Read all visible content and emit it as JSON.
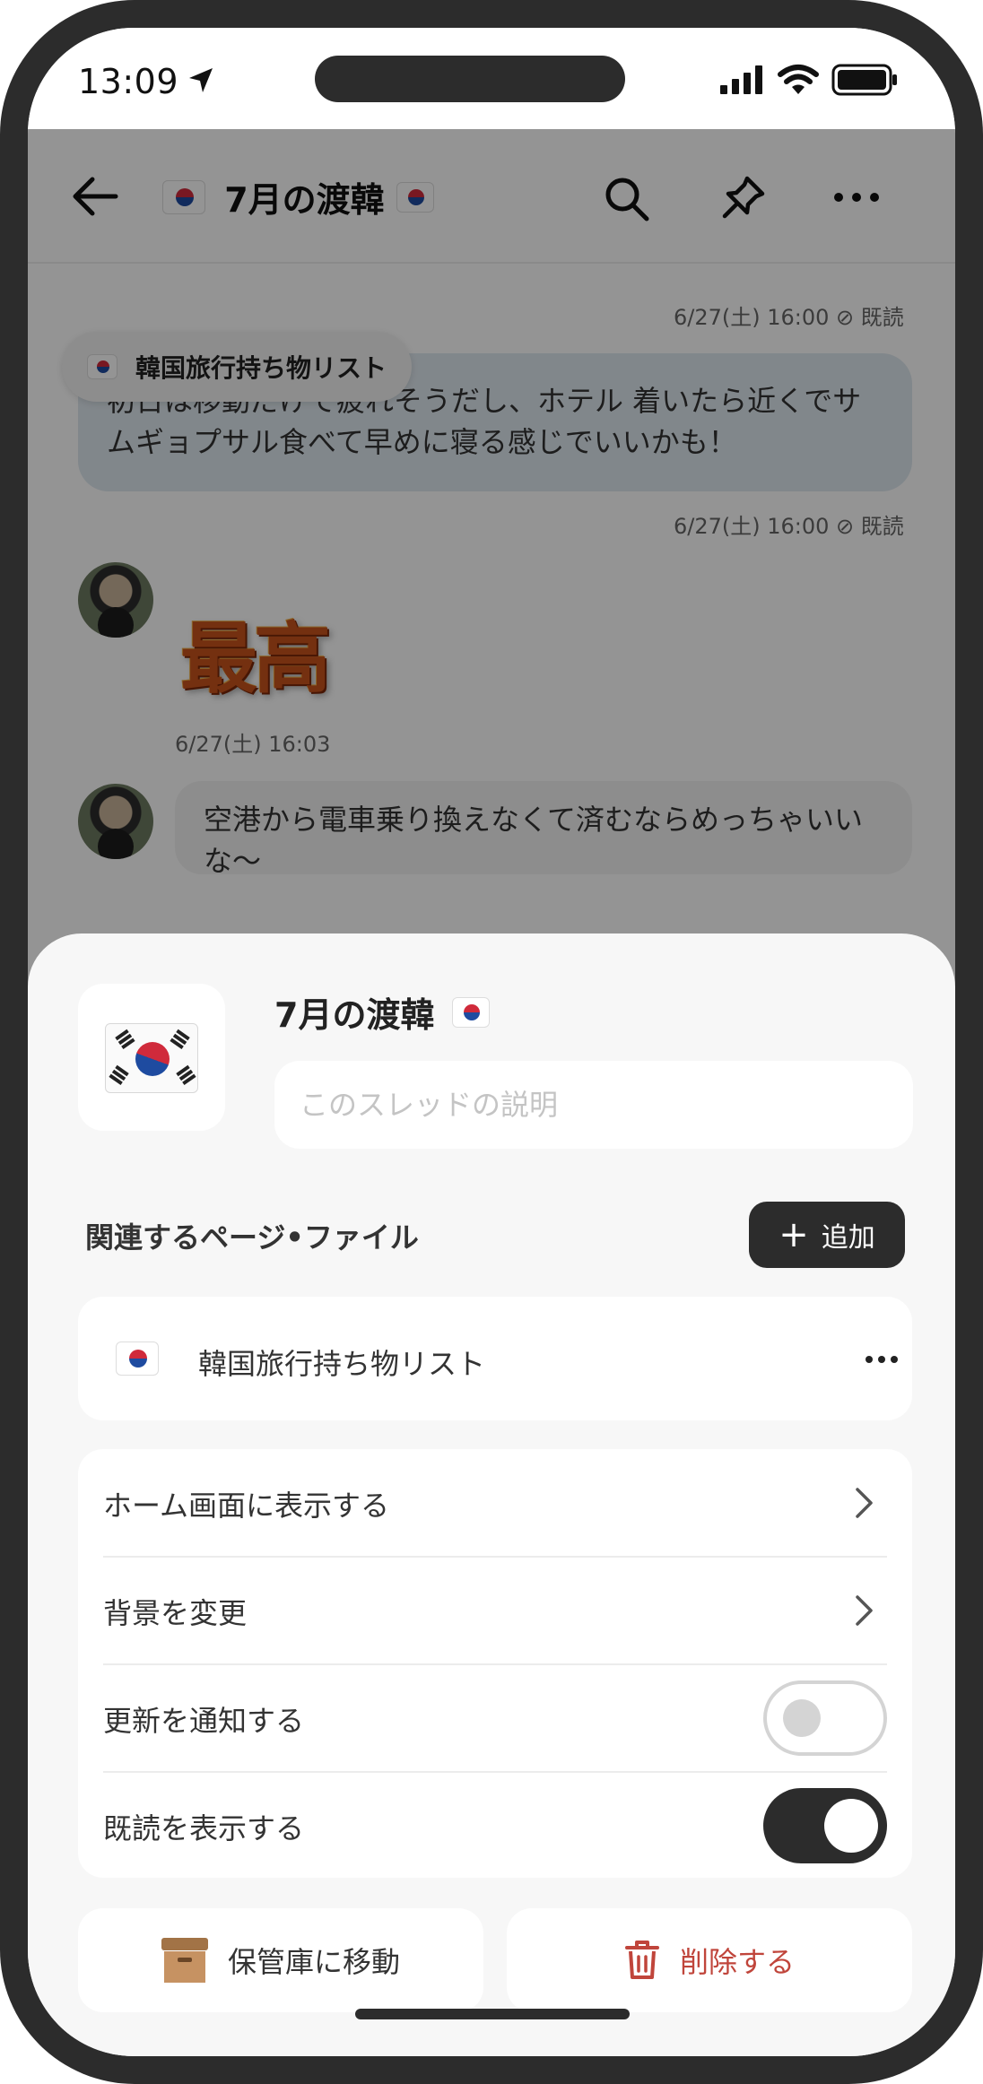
{
  "status_bar": {
    "time": "13:09"
  },
  "chat": {
    "thread_title": "7月の渡韓",
    "message1": {
      "text": "初日は移動だけで疲れそうだし、ホテル 着いたら近くでサムギョプサル食べて早めに寝る感じでいいかも！",
      "meta_above": "6/27(土) 16:00 ⊘ 既読",
      "meta_below": "6/27(土) 16:00 ⊘ 既読"
    },
    "pinned_chip": {
      "label": "韓国旅行持ち物リスト"
    },
    "sticker": {
      "text": "最高"
    },
    "message2": {
      "time": "6/27(土) 16:03",
      "text": "空港から電車乗り換えなくて済むならめっちゃいいな〜"
    }
  },
  "sheet": {
    "title": "7月の渡韓",
    "description": {
      "value": "",
      "placeholder": "このスレッドの説明"
    },
    "related_label": "関連するページ•ファイル",
    "add_label": "追加",
    "file_name": "韓国旅行持ち物リスト",
    "settings": [
      {
        "label": "ホーム画面に表示する",
        "control": "chevron"
      },
      {
        "label": "背景を変更",
        "control": "chevron"
      },
      {
        "label": "更新を通知する",
        "control": "toggle",
        "on": false
      },
      {
        "label": "既読を表示する",
        "control": "toggle",
        "on": true
      }
    ],
    "archive_label": "保管庫に移動",
    "delete_label": "削除する"
  },
  "colors": {
    "dark": "#2c2c2c",
    "sheet_bg": "#f7f7f7",
    "delete_red": "#c0453b",
    "my_bubble": "#dfe8ef"
  },
  "icons": [
    "location-arrow-icon",
    "signal-icon",
    "wifi-icon",
    "battery-icon",
    "back-arrow-icon",
    "korea-flag-icon",
    "search-icon",
    "pin-icon",
    "more-icon",
    "chevron-right-icon",
    "box-icon",
    "trash-icon"
  ]
}
